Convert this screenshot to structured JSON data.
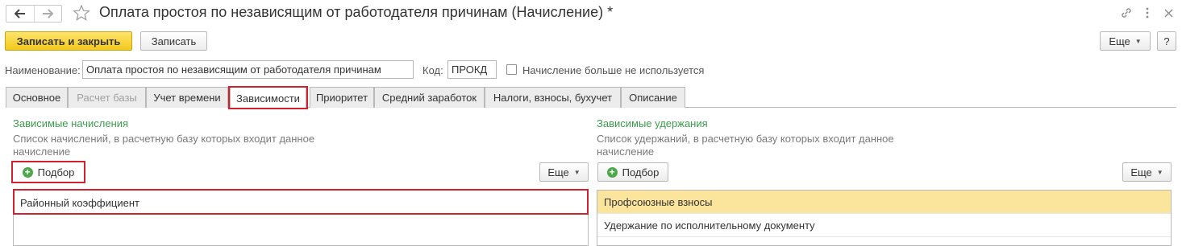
{
  "window": {
    "title": "Оплата простоя по независящим от работодателя причинам (Начисление) *"
  },
  "toolbar": {
    "save_close_label": "Записать и закрыть",
    "save_label": "Записать",
    "more_label": "Еще",
    "help_label": "?"
  },
  "header": {
    "name_label": "Наименование:",
    "name_value": "Оплата простоя по независящим от работодателя причинам",
    "code_label": "Код:",
    "code_value": "ПРОКД",
    "unused_label": "Начисление больше не используется"
  },
  "tabs": [
    {
      "label": "Основное"
    },
    {
      "label": "Расчет базы"
    },
    {
      "label": "Учет времени"
    },
    {
      "label": "Зависимости"
    },
    {
      "label": "Приоритет"
    },
    {
      "label": "Средний заработок"
    },
    {
      "label": "Налоги, взносы, бухучет"
    },
    {
      "label": "Описание"
    }
  ],
  "left_panel": {
    "title": "Зависимые начисления",
    "desc_line1": "Список начислений, в расчетную базу которых входит данное",
    "desc_line2": "начисление",
    "pick_label": "Подбор",
    "more_label": "Еще",
    "rows": [
      {
        "label": "Районный коэффициент"
      }
    ]
  },
  "right_panel": {
    "title": "Зависимые удержания",
    "desc_line1": "Список удержаний, в расчетную базу которых входит данное",
    "desc_line2": "начисление",
    "pick_label": "Подбор",
    "more_label": "Еще",
    "rows": [
      {
        "label": "Профсоюзные взносы"
      },
      {
        "label": "Удержание по исполнительному документу"
      }
    ]
  },
  "icons": {
    "back": "arrow-left-icon",
    "forward": "arrow-right-icon",
    "favorite": "star-icon",
    "link": "link-icon",
    "menu": "kebab-menu-icon",
    "close": "close-icon",
    "add": "plus-circle-icon"
  },
  "colors": {
    "primary_button": "#f4c91d",
    "group_title": "#3d9b4c",
    "highlight_outline": "#d0212f",
    "selected_row": "#fbe49c"
  }
}
